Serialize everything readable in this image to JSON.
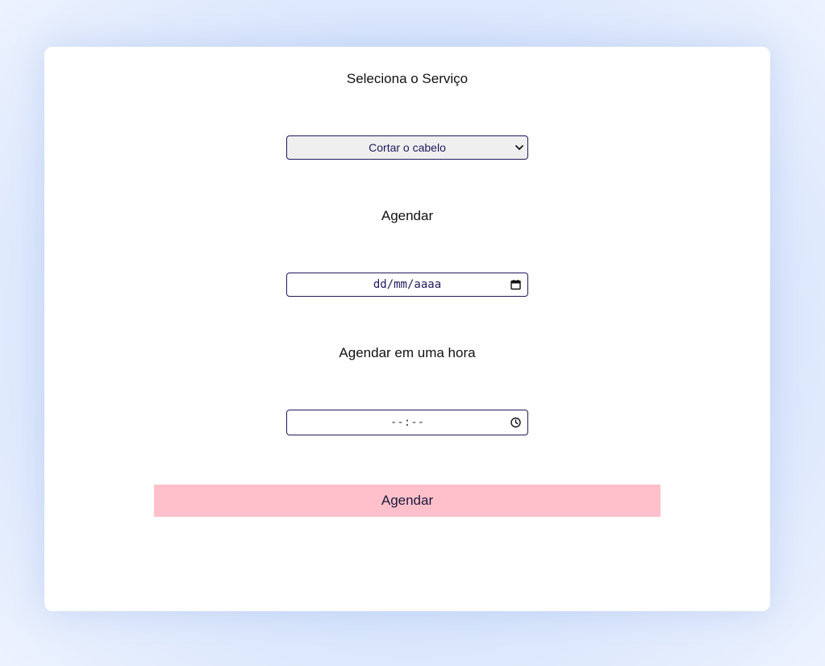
{
  "form": {
    "service_label": "Seleciona o Serviço",
    "service_selected": "Cortar o cabelo",
    "date_label": "Agendar",
    "date_placeholder": "dd/mm/aaaa",
    "time_label": "Agendar em uma hora",
    "time_placeholder": "--:--",
    "submit_label": "Agendar"
  },
  "icons": {
    "select_arrow": "chevron-down-icon",
    "date_picker": "calendar-icon",
    "time_picker": "clock-icon"
  },
  "colors": {
    "background": "#d6e4fc",
    "card": "#ffffff",
    "field_border": "#1f1a5c",
    "button": "#ffc0cb"
  }
}
